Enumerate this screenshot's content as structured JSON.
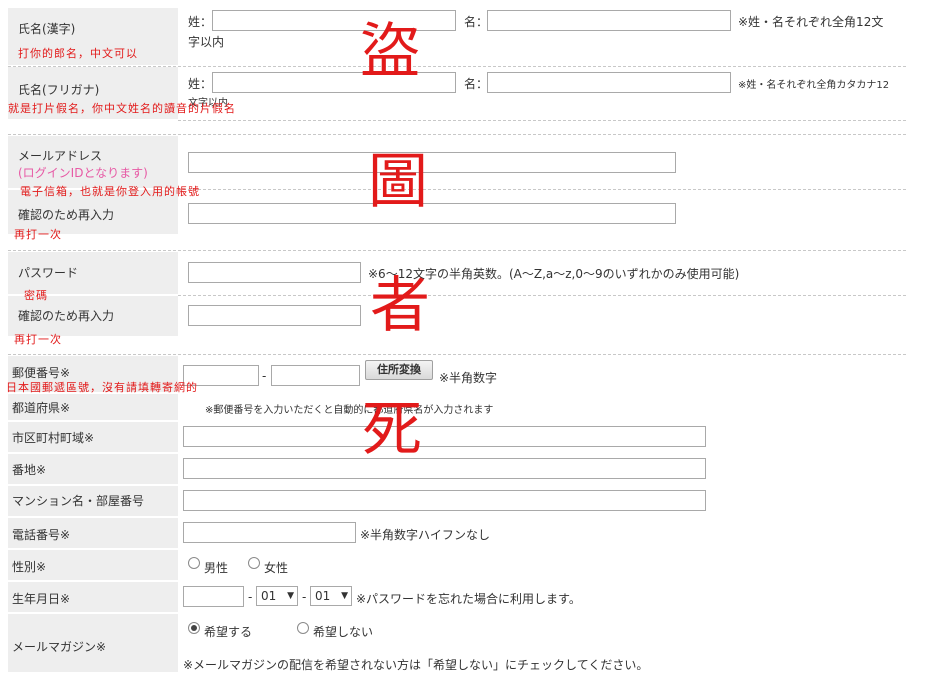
{
  "name_kanji": {
    "label": "氏名(漢字)",
    "sei": "姓：",
    "mei": "名：",
    "note_line1": "※姓・名それぞれ全角12文",
    "note_line2": "字以内",
    "annotation": "打你的郎名，中文可以"
  },
  "name_kana": {
    "label": "氏名(フリガナ)",
    "sei": "姓：",
    "mei": "名：",
    "note": "※姓・名それぞれ全角カタカナ12",
    "note_line2": "文字以内",
    "annotation": "就是打片假名，你中文姓名的讀音的片假名"
  },
  "email": {
    "label": "メールアドレス",
    "sublabel": "(ログインIDとなります)",
    "annotation": "電子信箱，也就是你登入用的帳號",
    "confirm_label": "確認のため再入力",
    "confirm_annotation": "再打一次"
  },
  "password": {
    "label": "パスワード",
    "note": "※6～12文字の半角英数。(A～Z,a～z,0～9のいずれかのみ使用可能)",
    "annotation": "密碼",
    "confirm_label": "確認のため再入力",
    "confirm_annotation": "再打一次"
  },
  "postal": {
    "label": "郵便番号※",
    "dash": "-",
    "button": "住所変換",
    "note": "※半角数字",
    "annotation": "日本國郵遞區號，沒有請填轉寄網的"
  },
  "prefecture": {
    "label": "都道府県※",
    "note": "※郵便番号を入力いただくと自動的に都道府県名が入力されます"
  },
  "city": {
    "label": "市区町村町域※"
  },
  "banchi": {
    "label": "番地※"
  },
  "mansion": {
    "label": "マンション名・部屋番号"
  },
  "phone": {
    "label": "電話番号※",
    "note": "※半角数字ハイフンなし"
  },
  "gender": {
    "label": "性別※",
    "male": "男性",
    "female": "女性"
  },
  "birthday": {
    "label": "生年月日※",
    "dash": "-",
    "month": "01",
    "day": "01",
    "note": "※パスワードを忘れた場合に利用します。"
  },
  "newsletter": {
    "label": "メールマガジン※",
    "yes": "希望する",
    "no": "希望しない",
    "note": "※メールマガジンの配信を希望されない方は「希望しない」にチェックしてください。"
  },
  "watermark": [
    "盜",
    "圖",
    "者",
    "死"
  ],
  "colors": {
    "annotation": "#e21a1a",
    "label_bg": "#eeeeee",
    "pink": "#e75aa5"
  }
}
